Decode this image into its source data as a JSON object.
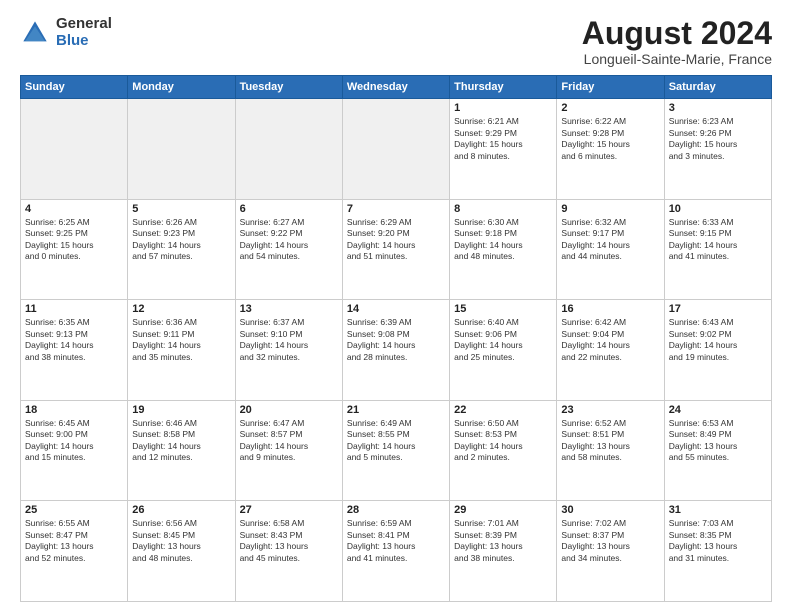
{
  "header": {
    "logo_general": "General",
    "logo_blue": "Blue",
    "main_title": "August 2024",
    "subtitle": "Longueil-Sainte-Marie, France"
  },
  "weekdays": [
    "Sunday",
    "Monday",
    "Tuesday",
    "Wednesday",
    "Thursday",
    "Friday",
    "Saturday"
  ],
  "weeks": [
    [
      {
        "day": "",
        "info": ""
      },
      {
        "day": "",
        "info": ""
      },
      {
        "day": "",
        "info": ""
      },
      {
        "day": "",
        "info": ""
      },
      {
        "day": "1",
        "info": "Sunrise: 6:21 AM\nSunset: 9:29 PM\nDaylight: 15 hours\nand 8 minutes."
      },
      {
        "day": "2",
        "info": "Sunrise: 6:22 AM\nSunset: 9:28 PM\nDaylight: 15 hours\nand 6 minutes."
      },
      {
        "day": "3",
        "info": "Sunrise: 6:23 AM\nSunset: 9:26 PM\nDaylight: 15 hours\nand 3 minutes."
      }
    ],
    [
      {
        "day": "4",
        "info": "Sunrise: 6:25 AM\nSunset: 9:25 PM\nDaylight: 15 hours\nand 0 minutes."
      },
      {
        "day": "5",
        "info": "Sunrise: 6:26 AM\nSunset: 9:23 PM\nDaylight: 14 hours\nand 57 minutes."
      },
      {
        "day": "6",
        "info": "Sunrise: 6:27 AM\nSunset: 9:22 PM\nDaylight: 14 hours\nand 54 minutes."
      },
      {
        "day": "7",
        "info": "Sunrise: 6:29 AM\nSunset: 9:20 PM\nDaylight: 14 hours\nand 51 minutes."
      },
      {
        "day": "8",
        "info": "Sunrise: 6:30 AM\nSunset: 9:18 PM\nDaylight: 14 hours\nand 48 minutes."
      },
      {
        "day": "9",
        "info": "Sunrise: 6:32 AM\nSunset: 9:17 PM\nDaylight: 14 hours\nand 44 minutes."
      },
      {
        "day": "10",
        "info": "Sunrise: 6:33 AM\nSunset: 9:15 PM\nDaylight: 14 hours\nand 41 minutes."
      }
    ],
    [
      {
        "day": "11",
        "info": "Sunrise: 6:35 AM\nSunset: 9:13 PM\nDaylight: 14 hours\nand 38 minutes."
      },
      {
        "day": "12",
        "info": "Sunrise: 6:36 AM\nSunset: 9:11 PM\nDaylight: 14 hours\nand 35 minutes."
      },
      {
        "day": "13",
        "info": "Sunrise: 6:37 AM\nSunset: 9:10 PM\nDaylight: 14 hours\nand 32 minutes."
      },
      {
        "day": "14",
        "info": "Sunrise: 6:39 AM\nSunset: 9:08 PM\nDaylight: 14 hours\nand 28 minutes."
      },
      {
        "day": "15",
        "info": "Sunrise: 6:40 AM\nSunset: 9:06 PM\nDaylight: 14 hours\nand 25 minutes."
      },
      {
        "day": "16",
        "info": "Sunrise: 6:42 AM\nSunset: 9:04 PM\nDaylight: 14 hours\nand 22 minutes."
      },
      {
        "day": "17",
        "info": "Sunrise: 6:43 AM\nSunset: 9:02 PM\nDaylight: 14 hours\nand 19 minutes."
      }
    ],
    [
      {
        "day": "18",
        "info": "Sunrise: 6:45 AM\nSunset: 9:00 PM\nDaylight: 14 hours\nand 15 minutes."
      },
      {
        "day": "19",
        "info": "Sunrise: 6:46 AM\nSunset: 8:58 PM\nDaylight: 14 hours\nand 12 minutes."
      },
      {
        "day": "20",
        "info": "Sunrise: 6:47 AM\nSunset: 8:57 PM\nDaylight: 14 hours\nand 9 minutes."
      },
      {
        "day": "21",
        "info": "Sunrise: 6:49 AM\nSunset: 8:55 PM\nDaylight: 14 hours\nand 5 minutes."
      },
      {
        "day": "22",
        "info": "Sunrise: 6:50 AM\nSunset: 8:53 PM\nDaylight: 14 hours\nand 2 minutes."
      },
      {
        "day": "23",
        "info": "Sunrise: 6:52 AM\nSunset: 8:51 PM\nDaylight: 13 hours\nand 58 minutes."
      },
      {
        "day": "24",
        "info": "Sunrise: 6:53 AM\nSunset: 8:49 PM\nDaylight: 13 hours\nand 55 minutes."
      }
    ],
    [
      {
        "day": "25",
        "info": "Sunrise: 6:55 AM\nSunset: 8:47 PM\nDaylight: 13 hours\nand 52 minutes."
      },
      {
        "day": "26",
        "info": "Sunrise: 6:56 AM\nSunset: 8:45 PM\nDaylight: 13 hours\nand 48 minutes."
      },
      {
        "day": "27",
        "info": "Sunrise: 6:58 AM\nSunset: 8:43 PM\nDaylight: 13 hours\nand 45 minutes."
      },
      {
        "day": "28",
        "info": "Sunrise: 6:59 AM\nSunset: 8:41 PM\nDaylight: 13 hours\nand 41 minutes."
      },
      {
        "day": "29",
        "info": "Sunrise: 7:01 AM\nSunset: 8:39 PM\nDaylight: 13 hours\nand 38 minutes."
      },
      {
        "day": "30",
        "info": "Sunrise: 7:02 AM\nSunset: 8:37 PM\nDaylight: 13 hours\nand 34 minutes."
      },
      {
        "day": "31",
        "info": "Sunrise: 7:03 AM\nSunset: 8:35 PM\nDaylight: 13 hours\nand 31 minutes."
      }
    ]
  ]
}
